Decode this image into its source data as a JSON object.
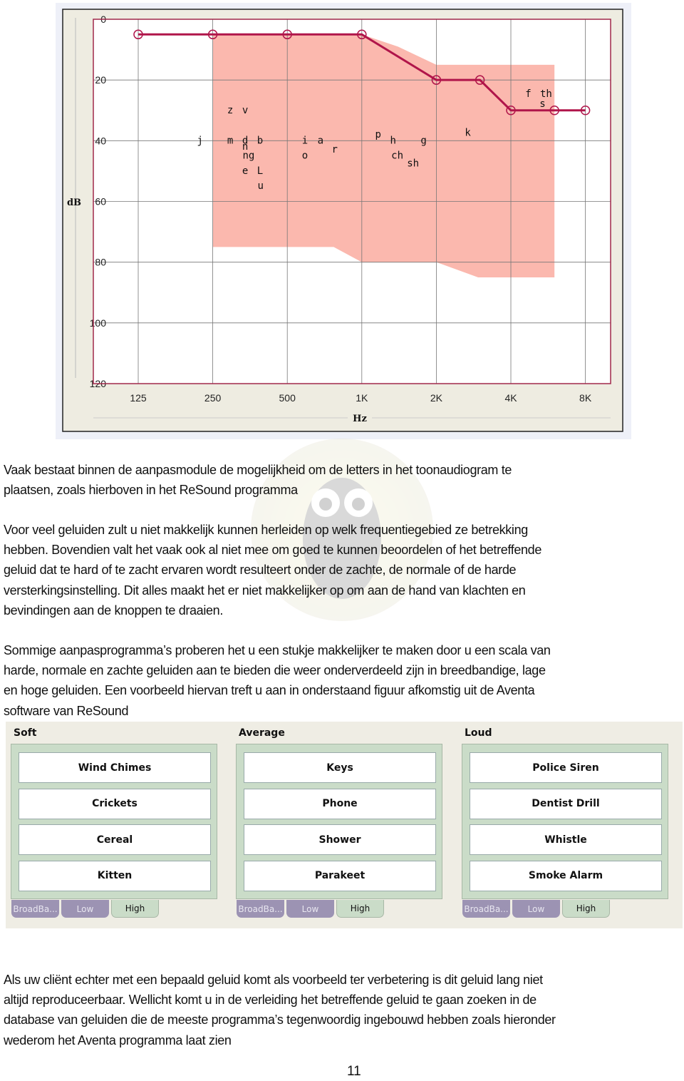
{
  "chart_data": {
    "type": "line",
    "xlabel": "Hz",
    "ylabel": "dB",
    "x_scale": "log2",
    "x_ticks": [
      "125",
      "250",
      "500",
      "1K",
      "2K",
      "4K",
      "8K"
    ],
    "x_tick_values": [
      125,
      250,
      500,
      1000,
      2000,
      4000,
      8000
    ],
    "y_ticks": [
      "0",
      "20",
      "40",
      "60",
      "80",
      "100",
      "120"
    ],
    "y_tick_values": [
      0,
      20,
      40,
      60,
      80,
      100,
      120
    ],
    "ylim": [
      0,
      120
    ],
    "y_inverted": true,
    "grid": true,
    "series": [
      {
        "x": [
          125,
          250,
          500,
          1000,
          2000,
          3000,
          4000,
          6000,
          8000
        ],
        "y": [
          5,
          5,
          5,
          5,
          20,
          20,
          30,
          30,
          30
        ],
        "color": "#b0154a"
      }
    ],
    "shaded_region": {
      "color": "#fbb8ae",
      "freq": [
        250,
        1000,
        1400,
        2000,
        6000,
        6000,
        2950,
        2000,
        1000,
        770,
        250
      ],
      "db": [
        5,
        5,
        9,
        15,
        15,
        85,
        85,
        80,
        80,
        75,
        75
      ]
    },
    "annotations": [
      {
        "text": "j",
        "x": 222,
        "y": 40
      },
      {
        "text": "m",
        "x": 294,
        "y": 40
      },
      {
        "text": "d",
        "x": 338,
        "y": 40
      },
      {
        "text": "b",
        "x": 388,
        "y": 40
      },
      {
        "text": "n",
        "x": 338,
        "y": 42
      },
      {
        "text": "ng",
        "x": 349,
        "y": 45
      },
      {
        "text": "e",
        "x": 338,
        "y": 50
      },
      {
        "text": "L",
        "x": 388,
        "y": 50
      },
      {
        "text": "u",
        "x": 390,
        "y": 55
      },
      {
        "text": "z",
        "x": 294,
        "y": 30
      },
      {
        "text": "v",
        "x": 338,
        "y": 30
      },
      {
        "text": "i",
        "x": 589,
        "y": 40
      },
      {
        "text": "a",
        "x": 681,
        "y": 40
      },
      {
        "text": "r",
        "x": 777,
        "y": 43
      },
      {
        "text": "o",
        "x": 589,
        "y": 45
      },
      {
        "text": "p",
        "x": 1164,
        "y": 38
      },
      {
        "text": "h",
        "x": 1338,
        "y": 40
      },
      {
        "text": "g",
        "x": 1777,
        "y": 40
      },
      {
        "text": "ch",
        "x": 1391,
        "y": 45
      },
      {
        "text": "sh",
        "x": 1610,
        "y": 47.5
      },
      {
        "text": "k",
        "x": 2680,
        "y": 37.5
      },
      {
        "text": "f",
        "x": 4705,
        "y": 24.6
      },
      {
        "text": "th",
        "x": 5550,
        "y": 24.6
      },
      {
        "text": "s",
        "x": 5370,
        "y": 28
      }
    ]
  },
  "paragraphs": [
    [
      "Vaak bestaat binnen de aanpasmodule de mogelijkheid om de letters in het toonaudiogram te",
      "plaatsen, zoals hierboven in het ReSound programma"
    ],
    [
      "Voor veel geluiden zult u niet makkelijk kunnen herleiden op welk frequentiegebied ze betrekking",
      "hebben. Bovendien valt het vaak ook al niet mee om goed te kunnen beoordelen of het betreffende",
      "geluid dat te hard of te zacht ervaren wordt resulteert onder de zachte, de normale of de harde",
      "versterkingsinstelling. Dit alles maakt het er niet makkelijker op om aan de hand van klachten en",
      "bevindingen aan de knoppen te draaien."
    ],
    [
      "Sommige aanpasprogramma’s proberen het u een stukje makkelijker te maken door u een scala van",
      "harde, normale en zachte geluiden aan te bieden die weer onderverdeeld zijn in breedbandige, lage",
      "en hoge geluiden. Een voorbeeld hiervan treft u aan in onderstaand figuur afkomstig uit de Aventa",
      "software van ReSound"
    ],
    [
      "Als uw cliënt echter met een bepaald geluid komt als voorbeeld ter verbetering is dit geluid lang niet",
      "altijd reproduceerbaar. Wellicht komt u in de verleiding het betreffende geluid te gaan zoeken in de",
      "database van geluiden die de meeste programma’s tegenwoordig ingebouwd hebben zoals hieronder",
      "wederom het Aventa programma laat zien"
    ]
  ],
  "sound_panel": {
    "groups": [
      {
        "title": "Soft",
        "sounds": [
          "Wind Chimes",
          "Crickets",
          "Cereal",
          "Kitten"
        ],
        "tabs": [
          "BroadBa...",
          "Low",
          "High"
        ],
        "selected_tab": "High"
      },
      {
        "title": "Average",
        "sounds": [
          "Keys",
          "Phone",
          "Shower",
          "Parakeet"
        ],
        "tabs": [
          "BroadBa...",
          "Low",
          "High"
        ],
        "selected_tab": "High"
      },
      {
        "title": "Loud",
        "sounds": [
          "Police Siren",
          "Dentist Drill",
          "Whistle",
          "Smoke Alarm"
        ],
        "tabs": [
          "BroadBa...",
          "Low",
          "High"
        ],
        "selected_tab": "High"
      }
    ]
  },
  "page_number": "11"
}
